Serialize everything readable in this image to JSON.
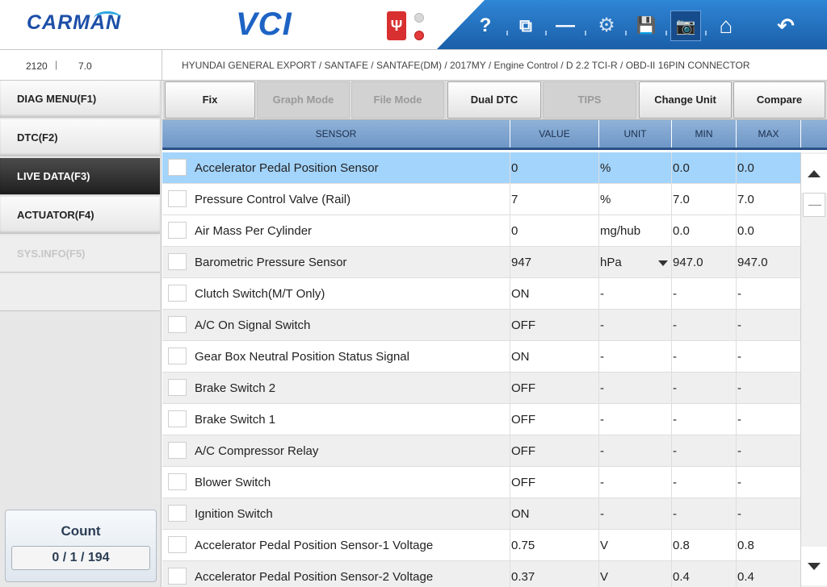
{
  "header": {
    "logo_text": "CARMAN",
    "product_text": "VCI",
    "usb_icon": "usb-icon",
    "tools": [
      {
        "name": "help",
        "glyph": "?"
      },
      {
        "name": "window",
        "glyph": "⧉"
      },
      {
        "name": "minimize",
        "glyph": "—"
      },
      {
        "name": "settings",
        "glyph": "⚙"
      },
      {
        "name": "save",
        "glyph": "💾"
      },
      {
        "name": "screenshot",
        "glyph": "📷"
      },
      {
        "name": "home",
        "glyph": "⌂"
      },
      {
        "name": "back",
        "glyph": "↶"
      }
    ]
  },
  "info": {
    "code": "2120",
    "separator": "|",
    "version": "7.0",
    "path": "HYUNDAI GENERAL EXPORT / SANTAFE / SANTAFE(DM) / 2017MY / Engine Control / D 2.2 TCI-R / OBD-II 16PIN CONNECTOR"
  },
  "sidebar": {
    "items": [
      {
        "label": "DIAG MENU(F1)",
        "state": "normal"
      },
      {
        "label": "DTC(F2)",
        "state": "normal"
      },
      {
        "label": "LIVE DATA(F3)",
        "state": "active"
      },
      {
        "label": "ACTUATOR(F4)",
        "state": "normal"
      },
      {
        "label": "SYS.INFO(F5)",
        "state": "disabled"
      }
    ],
    "count_label": "Count",
    "count_value": "0 / 1 / 194"
  },
  "buttons": [
    {
      "label": "Fix",
      "enabled": true
    },
    {
      "label": "Graph Mode",
      "enabled": false
    },
    {
      "label": "File Mode",
      "enabled": false
    },
    {
      "label": "Dual DTC",
      "enabled": true
    },
    {
      "label": "TIPS",
      "enabled": false
    },
    {
      "label": "Change Unit",
      "enabled": true
    },
    {
      "label": "Compare",
      "enabled": true
    }
  ],
  "table": {
    "headers": {
      "sensor": "SENSOR",
      "value": "VALUE",
      "unit": "UNIT",
      "min": "MIN",
      "max": "MAX"
    },
    "rows": [
      {
        "sensor": "Accelerator Pedal Position Sensor",
        "value": "0",
        "unit": "%",
        "min": "0.0",
        "max": "0.0"
      },
      {
        "sensor": "Pressure Control Valve (Rail)",
        "value": "7",
        "unit": "%",
        "min": "7.0",
        "max": "7.0"
      },
      {
        "sensor": "Air Mass Per Cylinder",
        "value": "0",
        "unit": "mg/hub",
        "min": "0.0",
        "max": "0.0"
      },
      {
        "sensor": "Barometric Pressure Sensor",
        "value": "947",
        "unit": "hPa",
        "min": "947.0",
        "max": "947.0"
      },
      {
        "sensor": "Clutch Switch(M/T Only)",
        "value": "ON",
        "unit": "-",
        "min": "-",
        "max": "-"
      },
      {
        "sensor": "A/C On Signal Switch",
        "value": "OFF",
        "unit": "-",
        "min": "-",
        "max": "-"
      },
      {
        "sensor": "Gear Box Neutral Position Status Signal",
        "value": "ON",
        "unit": "-",
        "min": "-",
        "max": "-"
      },
      {
        "sensor": "Brake Switch 2",
        "value": "OFF",
        "unit": "-",
        "min": "-",
        "max": "-"
      },
      {
        "sensor": "Brake Switch 1",
        "value": "OFF",
        "unit": "-",
        "min": "-",
        "max": "-"
      },
      {
        "sensor": "A/C Compressor Relay",
        "value": "OFF",
        "unit": "-",
        "min": "-",
        "max": "-"
      },
      {
        "sensor": "Blower Switch",
        "value": "OFF",
        "unit": "-",
        "min": "-",
        "max": "-"
      },
      {
        "sensor": "Ignition Switch",
        "value": "ON",
        "unit": "-",
        "min": "-",
        "max": "-"
      },
      {
        "sensor": "Accelerator Pedal Position Sensor-1 Voltage",
        "value": "0.75",
        "unit": "V",
        "min": "0.8",
        "max": "0.8"
      },
      {
        "sensor": "Accelerator Pedal Position Sensor-2 Voltage",
        "value": "0.37",
        "unit": "V",
        "min": "0.4",
        "max": "0.4"
      }
    ]
  },
  "colors": {
    "brand_blue": "#1d4fa8",
    "toolbar_blue": "#1a5ea8",
    "header_row": "#7fa6d0",
    "selected_row": "#a3d4fb"
  }
}
